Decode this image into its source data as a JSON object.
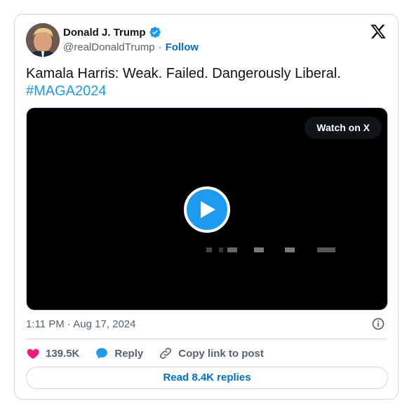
{
  "tweet": {
    "author_name": "Donald J. Trump",
    "handle": "@realDonaldTrump",
    "separator": "·",
    "follow_label": "Follow",
    "text": "Kamala Harris: Weak. Failed. Dangerously Liberal.",
    "hashtag": "#MAGA2024",
    "watch_label": "Watch on X",
    "timestamp": "1:11 PM · Aug 17, 2024",
    "likes_count": "139.5K",
    "reply_label": "Reply",
    "copy_link_label": "Copy link to post",
    "read_replies_label": "Read 8.4K replies"
  },
  "colors": {
    "accent": "#1d9bf0",
    "link": "#006fd6",
    "like": "#f91880",
    "text_secondary": "#536471",
    "border": "#cfd9de"
  },
  "icons": [
    "verified-badge-icon",
    "x-logo-icon",
    "play-icon",
    "heart-icon",
    "reply-bubble-icon",
    "link-icon",
    "info-icon"
  ]
}
